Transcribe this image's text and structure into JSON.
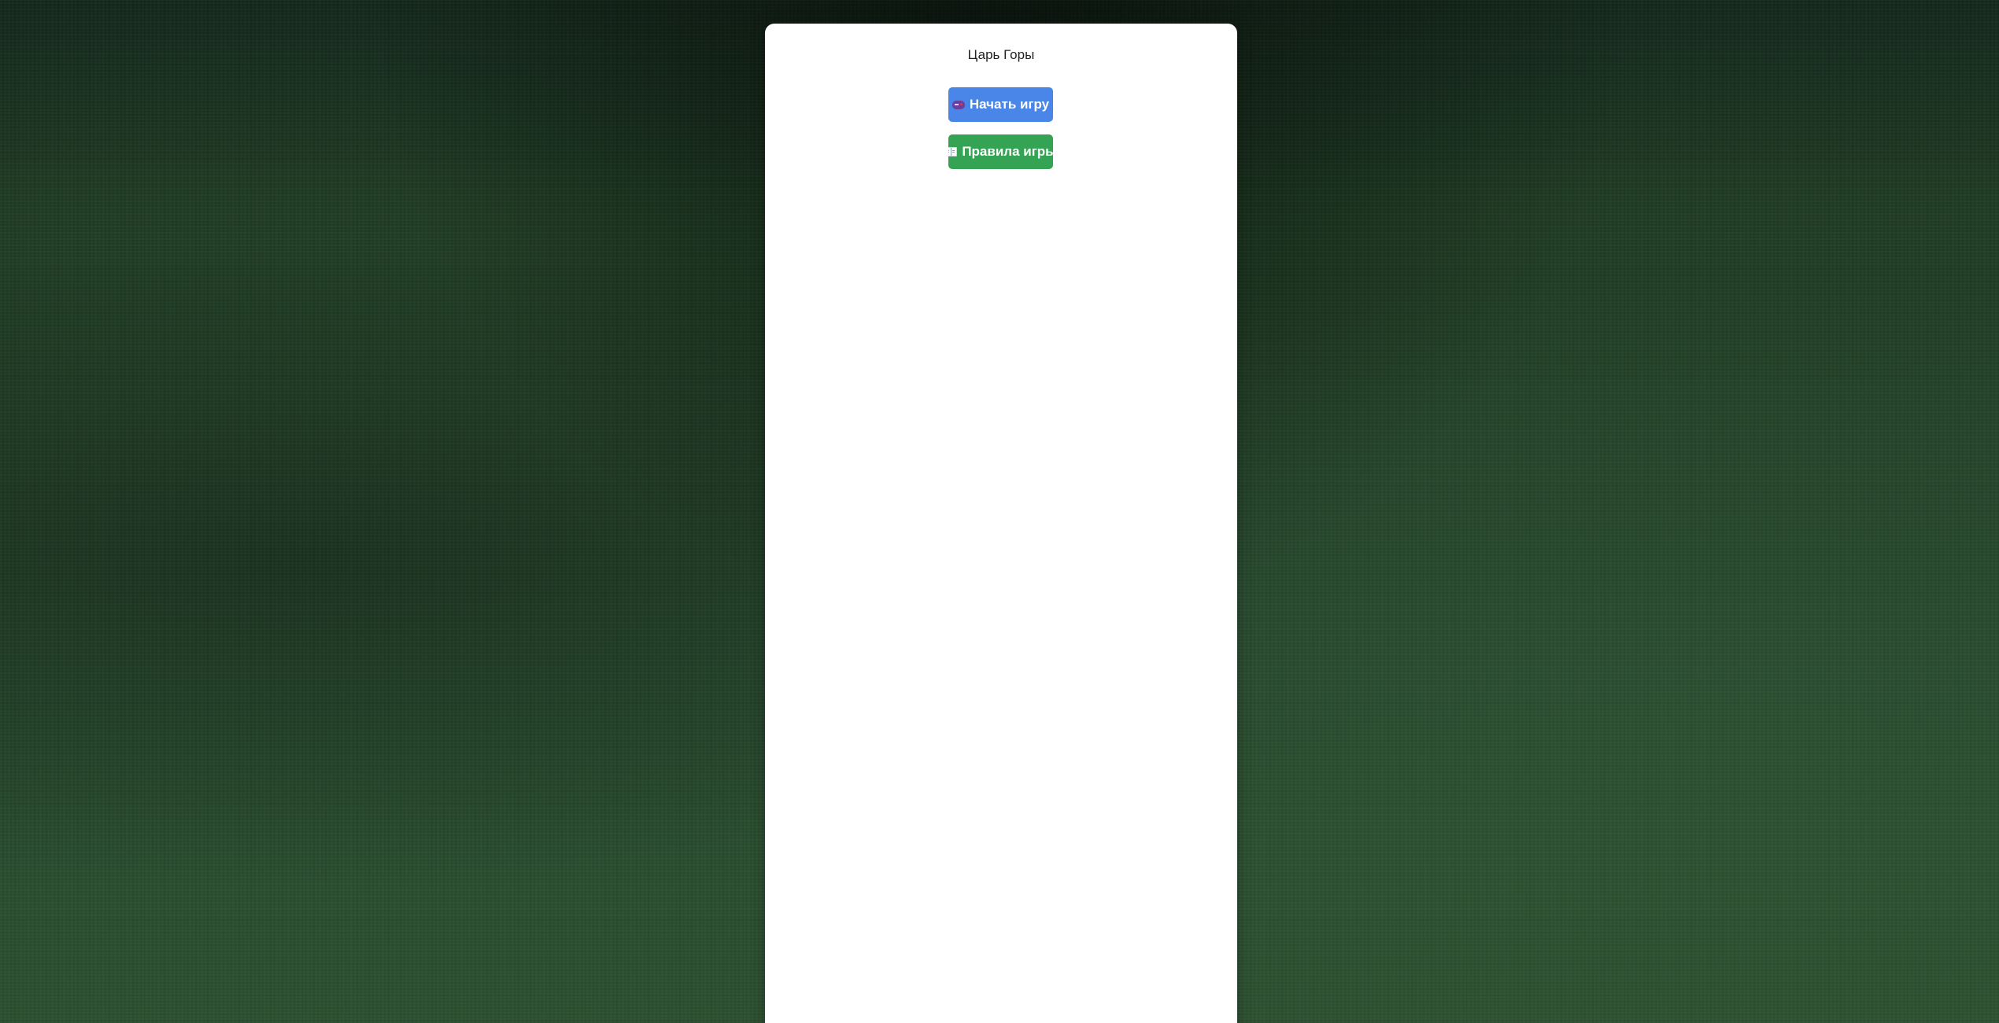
{
  "app": {
    "title": "Царь Горы"
  },
  "menu": {
    "start_button": {
      "label": "Начать игру",
      "icon": "gamepad-icon",
      "color": "#4a86e8"
    },
    "rules_button": {
      "label": "Правила игры",
      "icon": "book-icon",
      "color": "#34a354"
    }
  },
  "colors": {
    "background": "#1f3b22",
    "panel": "#ffffff"
  }
}
